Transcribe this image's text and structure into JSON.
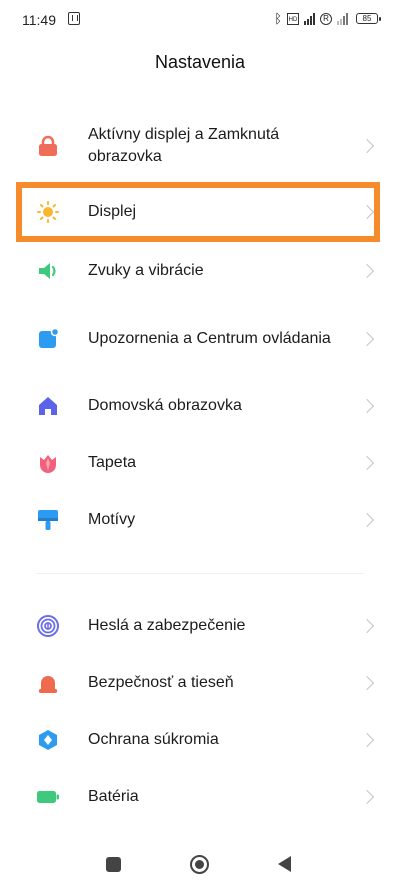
{
  "status_bar": {
    "time": "11:49",
    "bluetooth": "ᛒ",
    "volte": "4G",
    "r_indicator": "R",
    "battery": "85"
  },
  "page_title": "Nastavenia",
  "settings_groups": [
    {
      "items": [
        {
          "label": "Aktívny displej a Zamknutá obrazovka",
          "icon": "lock-icon",
          "color": "#ef6c5a"
        },
        {
          "label": "Displej",
          "icon": "sun-icon",
          "color": "#f7b731",
          "highlighted": true
        },
        {
          "label": "Zvuky a vibrácie",
          "icon": "speaker-icon",
          "color": "#3ec97c"
        },
        {
          "label": "Upozornenia a Centrum ovládania",
          "icon": "notification-icon",
          "color": "#2d9cf0"
        },
        {
          "label": "Domovská obrazovka",
          "icon": "home-icon",
          "color": "#5b63e8"
        },
        {
          "label": "Tapeta",
          "icon": "tulip-icon",
          "color": "#f2617a"
        },
        {
          "label": "Motívy",
          "icon": "brush-icon",
          "color": "#2d9cf0"
        }
      ]
    },
    {
      "items": [
        {
          "label": "Heslá a zabezpečenie",
          "icon": "fingerprint-icon",
          "color": "#6a6ee8"
        },
        {
          "label": "Bezpečnosť a tieseň",
          "icon": "alarm-icon",
          "color": "#f06a4f"
        },
        {
          "label": "Ochrana súkromia",
          "icon": "shield-icon",
          "color": "#2d9cf0"
        },
        {
          "label": "Batéria",
          "icon": "battery-icon",
          "color": "#3ec97c"
        }
      ]
    }
  ],
  "highlight_color": "#f68b2c"
}
